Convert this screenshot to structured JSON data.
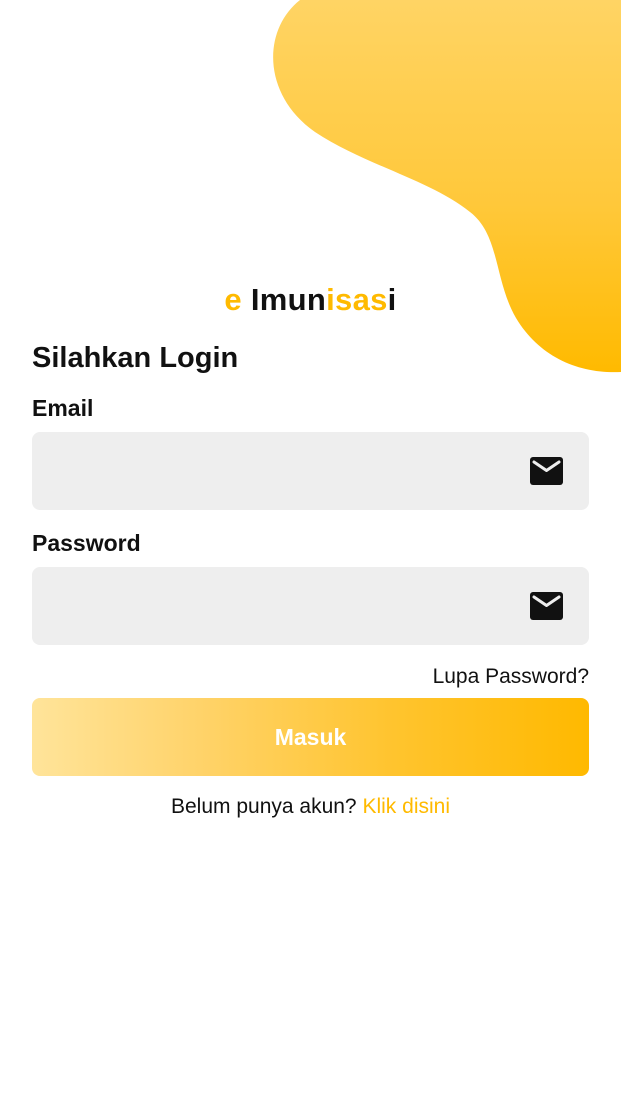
{
  "app": {
    "logo_parts": [
      "e",
      "Imun",
      "isas",
      "i"
    ],
    "accent_color": "#FFBA00"
  },
  "login": {
    "heading": "Silahkan Login",
    "email_label": "Email",
    "email_value": "",
    "email_icon": "mail-icon",
    "password_label": "Password",
    "password_value": "",
    "password_icon": "mail-icon",
    "forgot_label": "Lupa Password?",
    "submit_label": "Masuk",
    "signup_prompt": "Belum punya akun?",
    "signup_link": "Klik disini"
  }
}
